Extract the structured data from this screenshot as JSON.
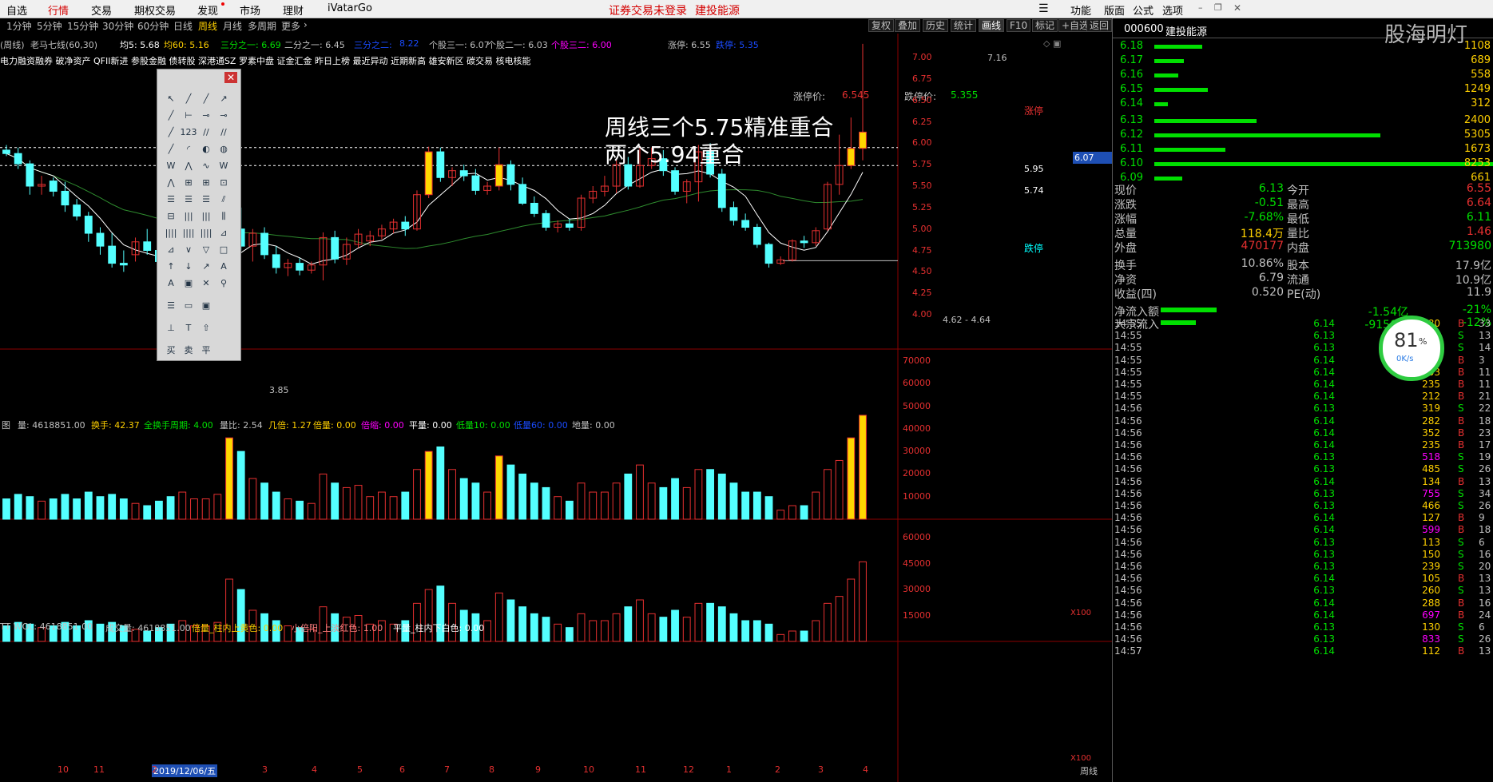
{
  "menu": {
    "items": [
      "自选",
      "行情",
      "交易",
      "期权交易",
      "发现",
      "市场",
      "理财",
      "iVatarGo"
    ],
    "active_index": 1,
    "warnings": [
      "证券交易未登录",
      "建投能源"
    ],
    "right_items": [
      "功能",
      "版面",
      "公式",
      "选项"
    ]
  },
  "periods": {
    "tabs": [
      "1分钟",
      "5分钟",
      "15分钟",
      "30分钟",
      "60分钟",
      "日线",
      "周线",
      "月线",
      "多周期",
      "更多"
    ],
    "selected": "周线",
    "buttons": [
      "复权",
      "叠加",
      "历史",
      "统计",
      "画线",
      "F10",
      "标记",
      "+自选",
      "返回"
    ],
    "selected_button": "画线"
  },
  "indicator": {
    "name_label": "(周线)",
    "title": "老马七线(60,30)",
    "items": [
      {
        "text": "均5: 5.68",
        "color": "#ffffff"
      },
      {
        "text": "均60: 5.16",
        "color": "#ffd000"
      },
      {
        "text": "三分之一: 6.69",
        "color": "#00e000"
      },
      {
        "text": "二分之一: 6.45",
        "color": "#c0c0c0"
      },
      {
        "text": "三分之二:",
        "color": "#1a4bff"
      },
      {
        "text": "8.22",
        "color": "#1a4bff"
      },
      {
        "text": "个股三一: 6.07",
        "color": "#c0c0c0"
      },
      {
        "text": "个股二一: 6.03",
        "color": "#c0c0c0"
      },
      {
        "text": "个股三二: 6.00",
        "color": "#ff00ff"
      },
      {
        "text": "涨停: 6.55",
        "color": "#c0c0c0"
      },
      {
        "text": "跌停: 5.35",
        "color": "#1a4bff"
      }
    ]
  },
  "concepts": "电力融资融券 破净资产 QFII新进 参股金融 债转股 深港通SZ 罗素中盘 证金汇金 昨日上榜 最近异动 近期新高 雄安新区 碳交易 核电核能",
  "chart": {
    "limit_up_label": "涨停价:",
    "limit_up_value": "6.545",
    "limit_down_label": "跌停价:",
    "limit_down_value": "5.355",
    "annotation_line1": "周线三个5.75精准重合",
    "annotation_line2": "两个5.94重合",
    "high_label": "7.16",
    "low_label": "3.85",
    "range_label": "4.62 - 4.64",
    "level1_label": "5.95",
    "level2_label": "5.74",
    "zhangting_tag": "涨停",
    "dieting_tag": "跌停",
    "price_tag": "6.07",
    "y_ticks": [
      "7.00",
      "6.75",
      "6.50",
      "6.25",
      "6.00",
      "5.75",
      "5.50",
      "5.25",
      "5.00",
      "4.75",
      "4.50",
      "4.25",
      "4.00"
    ]
  },
  "volume_panel": {
    "header": [
      {
        "text": "图",
        "color": "#c0c0c0"
      },
      {
        "text": "量: 4618851.00",
        "color": "#c0c0c0"
      },
      {
        "text": "换手: 42.37",
        "color": "#ffd000"
      },
      {
        "text": "全换手周期: 4.00",
        "color": "#00e000"
      },
      {
        "text": "量比: 2.54",
        "color": "#c0c0c0"
      },
      {
        "text": "几倍: 1.27",
        "color": "#ffd000"
      },
      {
        "text": "倍量: 0.00",
        "color": "#ffd000"
      },
      {
        "text": "倍缩: 0.00",
        "color": "#ff00ff"
      },
      {
        "text": "平量: 0.00",
        "color": "#ffffff"
      },
      {
        "text": "低量10: 0.00",
        "color": "#00e000"
      },
      {
        "text": "低量60: 0.00",
        "color": "#1a4bff"
      },
      {
        "text": "地量: 0.00",
        "color": "#c0c0c0"
      }
    ],
    "y_ticks": [
      "70000",
      "60000",
      "50000",
      "40000",
      "30000",
      "20000",
      "10000"
    ],
    "unit": "X100"
  },
  "vol2_panel": {
    "header": [
      {
        "text": "TT WOL: 4618851.00",
        "color": "#c0c0c0"
      },
      {
        "text": "成交量: 4618851.00",
        "color": "#c0c0c0"
      },
      {
        "text": "倍量_柱内上黄色: 0.00",
        "color": "#ffd000"
      },
      {
        "text": "小倍阳_上淡红色: 1.00",
        "color": "#ff8080"
      },
      {
        "text": "平量_柱内下白色: 0.00",
        "color": "#ffffff"
      }
    ],
    "y_ticks": [
      "60000",
      "45000",
      "30000",
      "15000"
    ],
    "unit": "X100"
  },
  "x_axis": {
    "labels": [
      "10",
      "11",
      "2019/12/06/五",
      "2",
      "3",
      "4",
      "5",
      "6",
      "7",
      "8",
      "9",
      "10",
      "11",
      "12",
      "1",
      "2",
      "3",
      "4"
    ],
    "corner": "周线"
  },
  "quote": {
    "code": "000600",
    "name": "建投能源",
    "watermark": "股海明灯",
    "asks": [
      {
        "price": "6.18",
        "vol": "1108",
        "bar": 60
      },
      {
        "price": "6.17",
        "vol": "689",
        "bar": 37
      },
      {
        "price": "6.16",
        "vol": "558",
        "bar": 30
      },
      {
        "price": "6.15",
        "vol": "1249",
        "bar": 67
      },
      {
        "price": "6.14",
        "vol": "312",
        "bar": 17
      }
    ],
    "bids": [
      {
        "price": "6.13",
        "vol": "2400",
        "bar": 128
      },
      {
        "price": "6.12",
        "vol": "5305",
        "bar": 283
      },
      {
        "price": "6.11",
        "vol": "1673",
        "bar": 89
      },
      {
        "price": "6.10",
        "vol": "8253",
        "bar": 440
      },
      {
        "price": "6.09",
        "vol": "661",
        "bar": 35
      }
    ],
    "stats": [
      {
        "l1": "现价",
        "v1": "6.13",
        "c1": "#00e000",
        "l2": "今开",
        "v2": "6.55",
        "c2": "#e63030"
      },
      {
        "l1": "涨跌",
        "v1": "-0.51",
        "c1": "#00e000",
        "l2": "最高",
        "v2": "6.64",
        "c2": "#e63030"
      },
      {
        "l1": "涨幅",
        "v1": "-7.68%",
        "c1": "#00e000",
        "l2": "最低",
        "v2": "6.11",
        "c2": "#00e000"
      },
      {
        "l1": "总量",
        "v1": "118.4万",
        "c1": "#ffd000",
        "l2": "量比",
        "v2": "1.46",
        "c2": "#e63030"
      },
      {
        "l1": "外盘",
        "v1": "470177",
        "c1": "#e63030",
        "l2": "内盘",
        "v2": "713980",
        "c2": "#00e000"
      },
      {
        "l1": "换手",
        "v1": "10.86%",
        "c1": "#c0c0c0",
        "l2": "股本",
        "v2": "17.9亿",
        "c2": "#c0c0c0"
      },
      {
        "l1": "净资",
        "v1": "6.79",
        "c1": "#c0c0c0",
        "l2": "流通",
        "v2": "10.9亿",
        "c2": "#c0c0c0"
      },
      {
        "l1": "收益(四)",
        "v1": "0.520",
        "c1": "#c0c0c0",
        "l2": "PE(动)",
        "v2": "11.9",
        "c2": "#c0c0c0"
      }
    ],
    "flows": [
      {
        "label": "净流入额",
        "value": "-1.54亿",
        "pct": "-21%"
      },
      {
        "label": "大宗流入",
        "value": "-9150万",
        "pct": "-12%"
      }
    ],
    "speed_pct": "81",
    "speed_unit": "%",
    "speed_rate": "0K/s",
    "ticks": [
      {
        "t": "14:55",
        "p": "6.14",
        "v": "280",
        "s": "B",
        "n": "33"
      },
      {
        "t": "14:55",
        "p": "6.13",
        "v": "60",
        "s": "S",
        "n": "13"
      },
      {
        "t": "14:55",
        "p": "6.13",
        "v": "111",
        "s": "S",
        "n": "14"
      },
      {
        "t": "14:55",
        "p": "6.14",
        "v": "30",
        "s": "B",
        "n": "3"
      },
      {
        "t": "14:55",
        "p": "6.14",
        "v": "103",
        "s": "B",
        "n": "11"
      },
      {
        "t": "14:55",
        "p": "6.14",
        "v": "235",
        "s": "B",
        "n": "11"
      },
      {
        "t": "14:55",
        "p": "6.14",
        "v": "212",
        "s": "B",
        "n": "21"
      },
      {
        "t": "14:56",
        "p": "6.13",
        "v": "319",
        "s": "S",
        "n": "22"
      },
      {
        "t": "14:56",
        "p": "6.14",
        "v": "282",
        "s": "B",
        "n": "18"
      },
      {
        "t": "14:56",
        "p": "6.14",
        "v": "352",
        "s": "B",
        "n": "23"
      },
      {
        "t": "14:56",
        "p": "6.14",
        "v": "235",
        "s": "B",
        "n": "17"
      },
      {
        "t": "14:56",
        "p": "6.13",
        "v": "518",
        "s": "S",
        "n": "19"
      },
      {
        "t": "14:56",
        "p": "6.13",
        "v": "485",
        "s": "S",
        "n": "26"
      },
      {
        "t": "14:56",
        "p": "6.14",
        "v": "134",
        "s": "B",
        "n": "13"
      },
      {
        "t": "14:56",
        "p": "6.13",
        "v": "755",
        "s": "S",
        "n": "34"
      },
      {
        "t": "14:56",
        "p": "6.13",
        "v": "466",
        "s": "S",
        "n": "26"
      },
      {
        "t": "14:56",
        "p": "6.14",
        "v": "127",
        "s": "B",
        "n": "9"
      },
      {
        "t": "14:56",
        "p": "6.14",
        "v": "599",
        "s": "B",
        "n": "18"
      },
      {
        "t": "14:56",
        "p": "6.13",
        "v": "113",
        "s": "S",
        "n": "6"
      },
      {
        "t": "14:56",
        "p": "6.13",
        "v": "150",
        "s": "S",
        "n": "16"
      },
      {
        "t": "14:56",
        "p": "6.13",
        "v": "239",
        "s": "S",
        "n": "20"
      },
      {
        "t": "14:56",
        "p": "6.14",
        "v": "105",
        "s": "B",
        "n": "13"
      },
      {
        "t": "14:56",
        "p": "6.13",
        "v": "260",
        "s": "S",
        "n": "13"
      },
      {
        "t": "14:56",
        "p": "6.14",
        "v": "288",
        "s": "B",
        "n": "16"
      },
      {
        "t": "14:56",
        "p": "6.14",
        "v": "697",
        "s": "B",
        "n": "24"
      },
      {
        "t": "14:56",
        "p": "6.13",
        "v": "130",
        "s": "S",
        "n": "6"
      },
      {
        "t": "14:56",
        "p": "6.13",
        "v": "833",
        "s": "S",
        "n": "26"
      },
      {
        "t": "14:57",
        "p": "6.14",
        "v": "112",
        "s": "B",
        "n": "13"
      }
    ]
  },
  "chart_data": {
    "type": "candlestick",
    "period": "weekly",
    "symbol": "000600",
    "y_range": [
      3.85,
      7.16
    ],
    "levels": [
      5.95,
      5.74
    ],
    "candles": [
      {
        "o": 5.92,
        "h": 5.98,
        "l": 5.85,
        "c": 5.88,
        "v": 9000
      },
      {
        "o": 5.88,
        "h": 5.95,
        "l": 5.7,
        "c": 5.76,
        "v": 11000
      },
      {
        "o": 5.76,
        "h": 5.8,
        "l": 5.4,
        "c": 5.5,
        "v": 10000
      },
      {
        "o": 5.5,
        "h": 5.62,
        "l": 5.4,
        "c": 5.52,
        "v": 8000
      },
      {
        "o": 5.56,
        "h": 5.6,
        "l": 5.38,
        "c": 5.44,
        "v": 9000
      },
      {
        "o": 5.44,
        "h": 5.55,
        "l": 5.2,
        "c": 5.28,
        "v": 11000
      },
      {
        "o": 5.28,
        "h": 5.35,
        "l": 5.1,
        "c": 5.15,
        "v": 9000
      },
      {
        "o": 5.15,
        "h": 5.2,
        "l": 4.85,
        "c": 4.95,
        "v": 12000
      },
      {
        "o": 4.95,
        "h": 5.02,
        "l": 4.7,
        "c": 4.8,
        "v": 10000
      },
      {
        "o": 4.8,
        "h": 4.95,
        "l": 4.55,
        "c": 4.6,
        "v": 11000
      },
      {
        "o": 4.6,
        "h": 4.75,
        "l": 4.5,
        "c": 4.58,
        "v": 9000
      },
      {
        "o": 4.7,
        "h": 4.9,
        "l": 4.62,
        "c": 4.85,
        "v": 7000
      },
      {
        "o": 4.85,
        "h": 5.0,
        "l": 4.7,
        "c": 4.75,
        "v": 6000
      },
      {
        "o": 4.75,
        "h": 4.85,
        "l": 4.55,
        "c": 4.62,
        "v": 8000
      },
      {
        "o": 4.45,
        "h": 4.6,
        "l": 4.2,
        "c": 4.3,
        "v": 10000
      },
      {
        "o": 4.32,
        "h": 4.48,
        "l": 3.85,
        "c": 4.45,
        "v": 12000
      },
      {
        "o": 4.45,
        "h": 4.6,
        "l": 4.38,
        "c": 4.5,
        "v": 9000
      },
      {
        "o": 4.5,
        "h": 4.68,
        "l": 4.42,
        "c": 4.62,
        "v": 9000
      },
      {
        "o": 4.62,
        "h": 4.75,
        "l": 4.55,
        "c": 4.7,
        "v": 11000
      },
      {
        "o": 4.6,
        "h": 5.3,
        "l": 4.55,
        "c": 5.0,
        "v": 36000
      },
      {
        "o": 5.0,
        "h": 5.25,
        "l": 4.75,
        "c": 4.8,
        "v": 30000
      },
      {
        "o": 4.8,
        "h": 5.0,
        "l": 4.62,
        "c": 4.95,
        "v": 18000
      },
      {
        "o": 4.95,
        "h": 5.02,
        "l": 4.65,
        "c": 4.7,
        "v": 16000
      },
      {
        "o": 4.7,
        "h": 4.8,
        "l": 4.48,
        "c": 4.55,
        "v": 12000
      },
      {
        "o": 4.55,
        "h": 4.65,
        "l": 4.45,
        "c": 4.6,
        "v": 9000
      },
      {
        "o": 4.6,
        "h": 4.66,
        "l": 4.46,
        "c": 4.52,
        "v": 8000
      },
      {
        "o": 4.52,
        "h": 4.62,
        "l": 4.48,
        "c": 4.58,
        "v": 7000
      },
      {
        "o": 4.58,
        "h": 4.96,
        "l": 4.4,
        "c": 4.9,
        "v": 20000
      },
      {
        "o": 4.9,
        "h": 4.98,
        "l": 4.6,
        "c": 4.65,
        "v": 16000
      },
      {
        "o": 4.65,
        "h": 4.9,
        "l": 4.58,
        "c": 4.82,
        "v": 14000
      },
      {
        "o": 4.82,
        "h": 5.0,
        "l": 4.78,
        "c": 4.94,
        "v": 15000
      },
      {
        "o": 4.86,
        "h": 4.98,
        "l": 4.8,
        "c": 4.92,
        "v": 10000
      },
      {
        "o": 4.92,
        "h": 5.05,
        "l": 4.88,
        "c": 5.0,
        "v": 12000
      },
      {
        "o": 5.0,
        "h": 5.12,
        "l": 4.95,
        "c": 5.08,
        "v": 10000
      },
      {
        "o": 5.08,
        "h": 5.15,
        "l": 4.92,
        "c": 5.0,
        "v": 12000
      },
      {
        "o": 5.0,
        "h": 5.45,
        "l": 4.98,
        "c": 5.4,
        "v": 22000
      },
      {
        "o": 5.4,
        "h": 5.96,
        "l": 5.36,
        "c": 5.9,
        "v": 30000
      },
      {
        "o": 5.9,
        "h": 5.95,
        "l": 5.55,
        "c": 5.6,
        "v": 32000
      },
      {
        "o": 5.6,
        "h": 5.72,
        "l": 5.5,
        "c": 5.68,
        "v": 22000
      },
      {
        "o": 5.68,
        "h": 5.75,
        "l": 5.56,
        "c": 5.62,
        "v": 18000
      },
      {
        "o": 5.62,
        "h": 5.7,
        "l": 5.4,
        "c": 5.45,
        "v": 16000
      },
      {
        "o": 5.45,
        "h": 5.55,
        "l": 5.4,
        "c": 5.5,
        "v": 12000
      },
      {
        "o": 5.5,
        "h": 5.95,
        "l": 5.45,
        "c": 5.75,
        "v": 28000
      },
      {
        "o": 5.75,
        "h": 5.8,
        "l": 5.45,
        "c": 5.52,
        "v": 24000
      },
      {
        "o": 5.52,
        "h": 5.6,
        "l": 5.28,
        "c": 5.3,
        "v": 20000
      },
      {
        "o": 5.3,
        "h": 5.38,
        "l": 5.14,
        "c": 5.18,
        "v": 16000
      },
      {
        "o": 5.18,
        "h": 5.22,
        "l": 4.98,
        "c": 5.02,
        "v": 14000
      },
      {
        "o": 5.02,
        "h": 5.1,
        "l": 4.96,
        "c": 5.06,
        "v": 10000
      },
      {
        "o": 5.06,
        "h": 5.12,
        "l": 4.98,
        "c": 5.02,
        "v": 8000
      },
      {
        "o": 5.02,
        "h": 5.4,
        "l": 4.98,
        "c": 5.36,
        "v": 16000
      },
      {
        "o": 5.36,
        "h": 5.5,
        "l": 5.3,
        "c": 5.44,
        "v": 12000
      },
      {
        "o": 5.44,
        "h": 5.62,
        "l": 5.38,
        "c": 5.5,
        "v": 12000
      },
      {
        "o": 5.5,
        "h": 5.82,
        "l": 5.42,
        "c": 5.75,
        "v": 16000
      },
      {
        "o": 5.75,
        "h": 5.84,
        "l": 5.46,
        "c": 5.5,
        "v": 20000
      },
      {
        "o": 5.5,
        "h": 5.96,
        "l": 5.48,
        "c": 5.74,
        "v": 24000
      },
      {
        "o": 5.74,
        "h": 5.95,
        "l": 5.7,
        "c": 5.82,
        "v": 16000
      },
      {
        "o": 5.82,
        "h": 5.92,
        "l": 5.62,
        "c": 5.68,
        "v": 14000
      },
      {
        "o": 5.68,
        "h": 5.72,
        "l": 5.4,
        "c": 5.44,
        "v": 18000
      },
      {
        "o": 5.44,
        "h": 5.58,
        "l": 5.3,
        "c": 5.55,
        "v": 14000
      },
      {
        "o": 5.55,
        "h": 5.98,
        "l": 5.32,
        "c": 5.9,
        "v": 22000
      },
      {
        "o": 5.9,
        "h": 6.0,
        "l": 5.6,
        "c": 5.64,
        "v": 22000
      },
      {
        "o": 5.64,
        "h": 5.7,
        "l": 5.2,
        "c": 5.25,
        "v": 20000
      },
      {
        "o": 5.25,
        "h": 5.32,
        "l": 5.04,
        "c": 5.1,
        "v": 16000
      },
      {
        "o": 5.1,
        "h": 5.18,
        "l": 4.98,
        "c": 5.02,
        "v": 12000
      },
      {
        "o": 5.02,
        "h": 5.06,
        "l": 4.78,
        "c": 4.82,
        "v": 12000
      },
      {
        "o": 4.82,
        "h": 4.84,
        "l": 4.55,
        "c": 4.6,
        "v": 10000
      },
      {
        "o": 4.6,
        "h": 4.68,
        "l": 4.58,
        "c": 4.64,
        "v": 4000
      },
      {
        "o": 4.64,
        "h": 4.88,
        "l": 4.62,
        "c": 4.86,
        "v": 6000
      },
      {
        "o": 4.86,
        "h": 4.92,
        "l": 4.78,
        "c": 4.84,
        "v": 6000
      },
      {
        "o": 4.84,
        "h": 5.02,
        "l": 4.8,
        "c": 4.98,
        "v": 12000
      },
      {
        "o": 5.0,
        "h": 5.55,
        "l": 4.98,
        "c": 5.52,
        "v": 22000
      },
      {
        "o": 5.52,
        "h": 6.1,
        "l": 5.4,
        "c": 5.74,
        "v": 26000
      },
      {
        "o": 5.74,
        "h": 6.3,
        "l": 5.7,
        "c": 5.94,
        "v": 36000
      },
      {
        "o": 5.94,
        "h": 7.16,
        "l": 5.8,
        "c": 6.13,
        "v": 46000
      }
    ]
  }
}
